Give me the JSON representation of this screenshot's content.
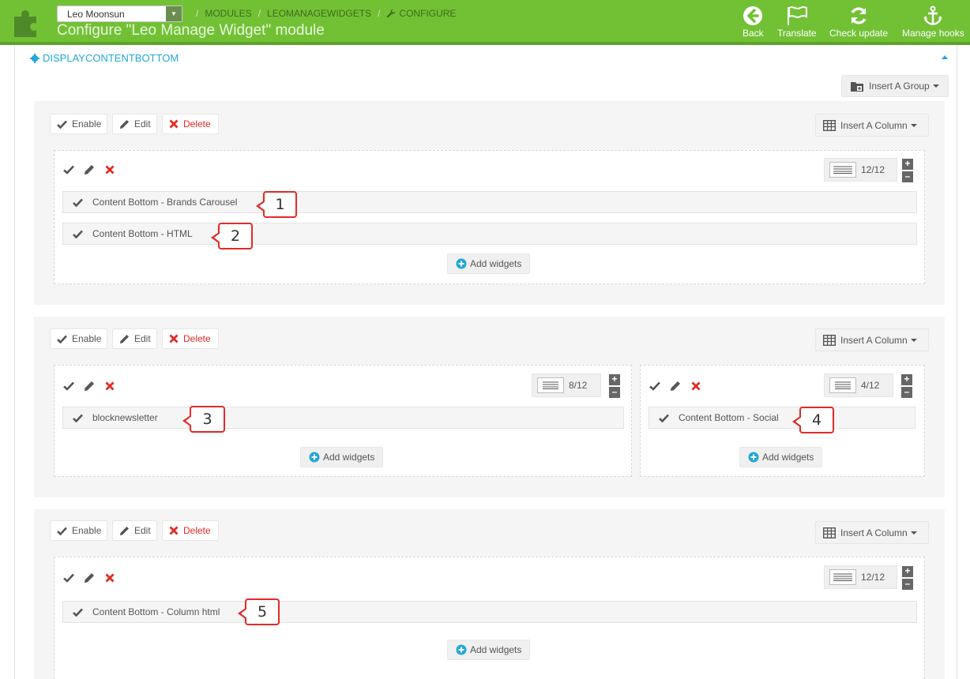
{
  "header": {
    "shop_select_value": "Leo Moonsun",
    "breadcrumb": [
      "MODULES",
      "LEOMANAGEWIDGETS",
      "CONFIGURE"
    ],
    "page_title": "Configure \"Leo Manage Widget\" module",
    "toolbar": [
      {
        "label": "Back",
        "icon": "back-arrow-icon"
      },
      {
        "label": "Translate",
        "icon": "flag-icon"
      },
      {
        "label": "Check update",
        "icon": "refresh-icon"
      },
      {
        "label": "Manage hooks",
        "icon": "anchor-icon"
      }
    ]
  },
  "section": {
    "title": "DISPLAYCONTENTBOTTOM",
    "insert_group_label": "Insert A Group"
  },
  "group_buttons": {
    "enable": "Enable",
    "edit": "Edit",
    "delete": "Delete",
    "insert_column": "Insert A Column",
    "add_widgets": "Add widgets"
  },
  "groups": [
    {
      "columns": [
        {
          "width": "12/12",
          "widgets": [
            {
              "label": "Content Bottom - Brands Carousel",
              "callout": "1"
            },
            {
              "label": "Content Bottom - HTML",
              "callout": "2"
            }
          ]
        }
      ]
    },
    {
      "columns": [
        {
          "width": "8/12",
          "widgets": [
            {
              "label": "blocknewsletter",
              "callout": "3"
            }
          ]
        },
        {
          "width": "4/12",
          "widgets": [
            {
              "label": "Content Bottom - Social",
              "callout": "4"
            }
          ]
        }
      ]
    },
    {
      "columns": [
        {
          "width": "12/12",
          "widgets": [
            {
              "label": "Content Bottom - Column html",
              "callout": "5"
            }
          ]
        }
      ]
    }
  ],
  "colors": {
    "header_green": "#72c135",
    "accent_blue": "#22a7d8",
    "delete_red": "#e02b27"
  }
}
